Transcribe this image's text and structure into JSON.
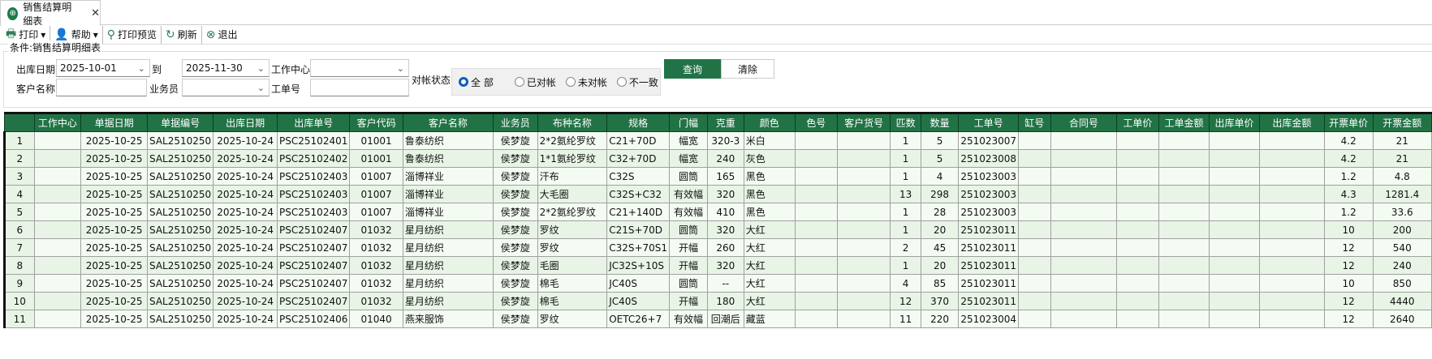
{
  "tab": {
    "title": "销售结算明细表",
    "icon": "globe-icon"
  },
  "toolbar": [
    {
      "label": "打印",
      "icon": "printer-icon",
      "dropdown": true
    },
    {
      "label": "帮助",
      "icon": "help-icon",
      "dropdown": true
    },
    {
      "label": "打印预览",
      "icon": "search-icon"
    },
    {
      "label": "刷新",
      "icon": "refresh-icon"
    },
    {
      "label": "退出",
      "icon": "exit-icon"
    }
  ],
  "filter": {
    "legend": "条件:销售结算明细表",
    "date_from_label": "出库日期",
    "date_from": "2025-10-01",
    "to_label": "到",
    "date_to": "2025-11-30",
    "workcenter_label": "工作中心",
    "workcenter": "",
    "customer_label": "客户名称",
    "customer": "",
    "salesman_label": "业务员",
    "salesman": "",
    "workorder_label": "工单号",
    "workorder": "",
    "status_label": "对帐状态",
    "status_options": [
      "全 部",
      "已对帐",
      "未对帐",
      "不一致"
    ],
    "status_selected": "全 部",
    "query": "查询",
    "clear": "清除"
  },
  "columns": [
    "",
    "工作中心",
    "单据日期",
    "单据编号",
    "出库日期",
    "出库单号",
    "客户代码",
    "客户名称",
    "业务员",
    "布种名称",
    "规格",
    "门幅",
    "克重",
    "颜色",
    "色号",
    "客户货号",
    "匹数",
    "数量",
    "工单号",
    "缸号",
    "合同号",
    "工单价",
    "工单金额",
    "出库单价",
    "出库金额",
    "开票单价",
    "开票金额"
  ],
  "rows": [
    [
      "1",
      "",
      "2025-10-25",
      "SAL2510250",
      "2025-10-24",
      "PSC25102401",
      "01001",
      "鲁泰纺织",
      "侯梦旋",
      "2*2氨纶罗纹",
      "C21+70D",
      "幅宽",
      "320-3",
      "米白",
      "",
      "",
      "1",
      "5",
      "251023007",
      "",
      "",
      "",
      "",
      "",
      "",
      "4.2",
      "21"
    ],
    [
      "2",
      "",
      "2025-10-25",
      "SAL2510250",
      "2025-10-24",
      "PSC25102402",
      "01001",
      "鲁泰纺织",
      "侯梦旋",
      "1*1氨纶罗纹",
      "C32+70D",
      "幅宽",
      "240",
      "灰色",
      "",
      "",
      "1",
      "5",
      "251023008",
      "",
      "",
      "",
      "",
      "",
      "",
      "4.2",
      "21"
    ],
    [
      "3",
      "",
      "2025-10-25",
      "SAL2510250",
      "2025-10-24",
      "PSC25102403",
      "01007",
      "淄博祥业",
      "侯梦旋",
      "汗布",
      "C32S",
      "圆筒",
      "165",
      "黑色",
      "",
      "",
      "1",
      "4",
      "251023003",
      "",
      "",
      "",
      "",
      "",
      "",
      "1.2",
      "4.8"
    ],
    [
      "4",
      "",
      "2025-10-25",
      "SAL2510250",
      "2025-10-24",
      "PSC25102403",
      "01007",
      "淄博祥业",
      "侯梦旋",
      "大毛圈",
      "C32S+C32",
      "有效幅",
      "320",
      "黑色",
      "",
      "",
      "13",
      "298",
      "251023003",
      "",
      "",
      "",
      "",
      "",
      "",
      "4.3",
      "1281.4"
    ],
    [
      "5",
      "",
      "2025-10-25",
      "SAL2510250",
      "2025-10-24",
      "PSC25102403",
      "01007",
      "淄博祥业",
      "侯梦旋",
      "2*2氨纶罗纹",
      "C21+140D",
      "有效幅",
      "410",
      "黑色",
      "",
      "",
      "1",
      "28",
      "251023003",
      "",
      "",
      "",
      "",
      "",
      "",
      "1.2",
      "33.6"
    ],
    [
      "6",
      "",
      "2025-10-25",
      "SAL2510250",
      "2025-10-24",
      "PSC25102407",
      "01032",
      "星月纺织",
      "侯梦旋",
      "罗纹",
      "C21S+70D",
      "圆筒",
      "320",
      "大红",
      "",
      "",
      "1",
      "20",
      "251023011",
      "",
      "",
      "",
      "",
      "",
      "",
      "10",
      "200"
    ],
    [
      "7",
      "",
      "2025-10-25",
      "SAL2510250",
      "2025-10-24",
      "PSC25102407",
      "01032",
      "星月纺织",
      "侯梦旋",
      "罗纹",
      "C32S+70S1",
      "开幅",
      "260",
      "大红",
      "",
      "",
      "2",
      "45",
      "251023011",
      "",
      "",
      "",
      "",
      "",
      "",
      "12",
      "540"
    ],
    [
      "8",
      "",
      "2025-10-25",
      "SAL2510250",
      "2025-10-24",
      "PSC25102407",
      "01032",
      "星月纺织",
      "侯梦旋",
      "毛圈",
      "JC32S+10S",
      "开幅",
      "320",
      "大红",
      "",
      "",
      "1",
      "20",
      "251023011",
      "",
      "",
      "",
      "",
      "",
      "",
      "12",
      "240"
    ],
    [
      "9",
      "",
      "2025-10-25",
      "SAL2510250",
      "2025-10-24",
      "PSC25102407",
      "01032",
      "星月纺织",
      "侯梦旋",
      "棉毛",
      "JC40S",
      "圆筒",
      "--",
      "大红",
      "",
      "",
      "4",
      "85",
      "251023011",
      "",
      "",
      "",
      "",
      "",
      "",
      "10",
      "850"
    ],
    [
      "10",
      "",
      "2025-10-25",
      "SAL2510250",
      "2025-10-24",
      "PSC25102407",
      "01032",
      "星月纺织",
      "侯梦旋",
      "棉毛",
      "JC40S",
      "开幅",
      "180",
      "大红",
      "",
      "",
      "12",
      "370",
      "251023011",
      "",
      "",
      "",
      "",
      "",
      "",
      "12",
      "4440"
    ],
    [
      "11",
      "",
      "2025-10-25",
      "SAL2510250",
      "2025-10-24",
      "PSC25102406",
      "01040",
      "燕来服饰",
      "侯梦旋",
      "罗纹",
      "OETC26+7",
      "有效幅",
      "回潮后",
      "藏蓝",
      "",
      "",
      "11",
      "220",
      "251023004",
      "",
      "",
      "",
      "",
      "",
      "",
      "12",
      "2640"
    ]
  ],
  "colors": {
    "header_bg": "#217346",
    "row_odd": "#f4fbf3",
    "row_even": "#e8f5e6",
    "radio_selected": "#0a5cc0"
  }
}
